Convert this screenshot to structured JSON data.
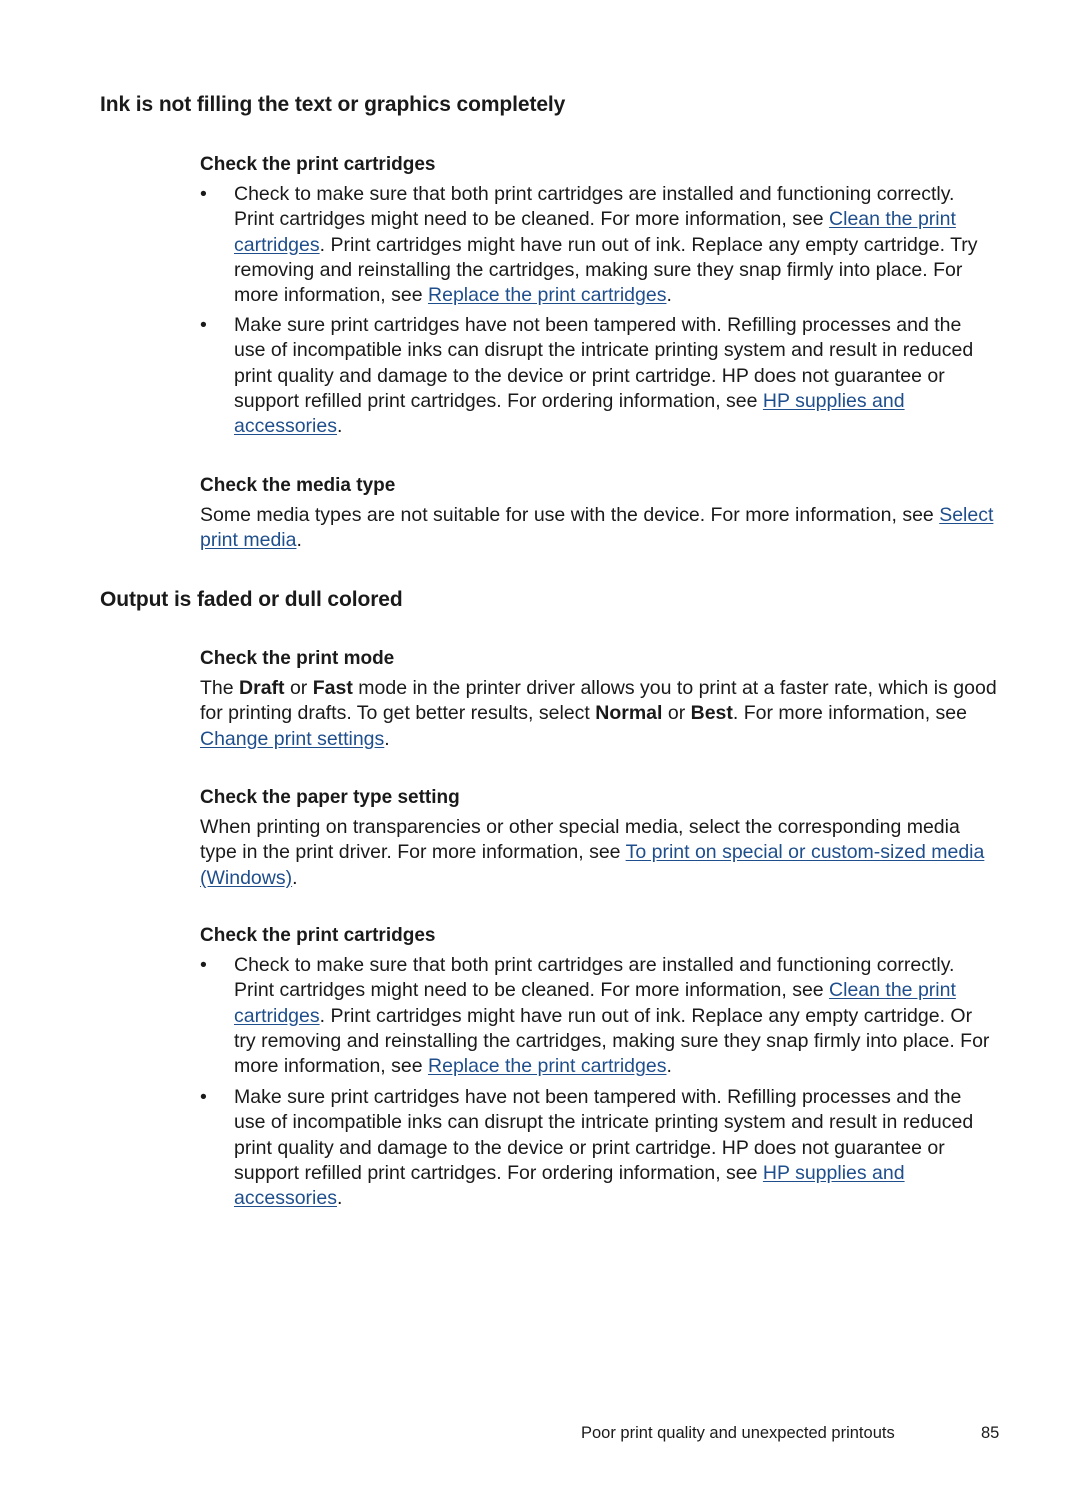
{
  "section1": {
    "title": "Ink is not filling the text or graphics completely",
    "check_cartridges": {
      "heading": "Check the print cartridges",
      "bullet1": {
        "text_a": "Check to make sure that both print cartridges are installed and functioning correctly. Print cartridges might need to be cleaned. For more information, see ",
        "link1": "Clean the print cartridges",
        "text_b": ". Print cartridges might have run out of ink. Replace any empty cartridge. Try removing and reinstalling the cartridges, making sure they snap firmly into place. For more information, see ",
        "link2": "Replace the print cartridges",
        "text_c": "."
      },
      "bullet2": {
        "text_a": "Make sure print cartridges have not been tampered with. Refilling processes and the use of incompatible inks can disrupt the intricate printing system and result in reduced print quality and damage to the device or print cartridge. HP does not guarantee or support refilled print cartridges. For ordering information, see ",
        "link1": "HP supplies and accessories",
        "text_b": "."
      }
    },
    "check_media": {
      "heading": "Check the media type",
      "text_a": "Some media types are not suitable for use with the device. For more information, see ",
      "link1": "Select print media",
      "text_b": "."
    }
  },
  "section2": {
    "title": "Output is faded or dull colored",
    "check_mode": {
      "heading": "Check the print mode",
      "t1": "The ",
      "b1": "Draft",
      "t2": " or ",
      "b2": "Fast",
      "t3": " mode in the printer driver allows you to print at a faster rate, which is good for printing drafts. To get better results, select ",
      "b3": "Normal",
      "t4": " or ",
      "b4": "Best",
      "t5": ". For more information, see ",
      "link1": "Change print settings",
      "t6": "."
    },
    "check_paper": {
      "heading": "Check the paper type setting",
      "text_a": "When printing on transparencies or other special media, select the corresponding media type in the print driver. For more information, see ",
      "link1": "To print on special or custom-sized media (Windows)",
      "text_b": "."
    },
    "check_cartridges": {
      "heading": "Check the print cartridges",
      "bullet1": {
        "text_a": "Check to make sure that both print cartridges are installed and functioning correctly. Print cartridges might need to be cleaned. For more information, see ",
        "link1": "Clean the print cartridges",
        "text_b": ". Print cartridges might have run out of ink. Replace any empty cartridge. Or try removing and reinstalling the cartridges, making sure they snap firmly into place. For more information, see ",
        "link2": "Replace the print cartridges",
        "text_c": "."
      },
      "bullet2": {
        "text_a": "Make sure print cartridges have not been tampered with. Refilling processes and the use of incompatible inks can disrupt the intricate printing system and result in reduced print quality and damage to the device or print cartridge. HP does not guarantee or support refilled print cartridges. For ordering information, see ",
        "link1": "HP supplies and accessories",
        "text_b": "."
      }
    }
  },
  "bullet_glyph": "•",
  "footer": {
    "chapter": "Poor print quality and unexpected printouts",
    "page_number": "85"
  },
  "colors": {
    "link": "#1f4e8c",
    "text": "#1a1a1a"
  }
}
